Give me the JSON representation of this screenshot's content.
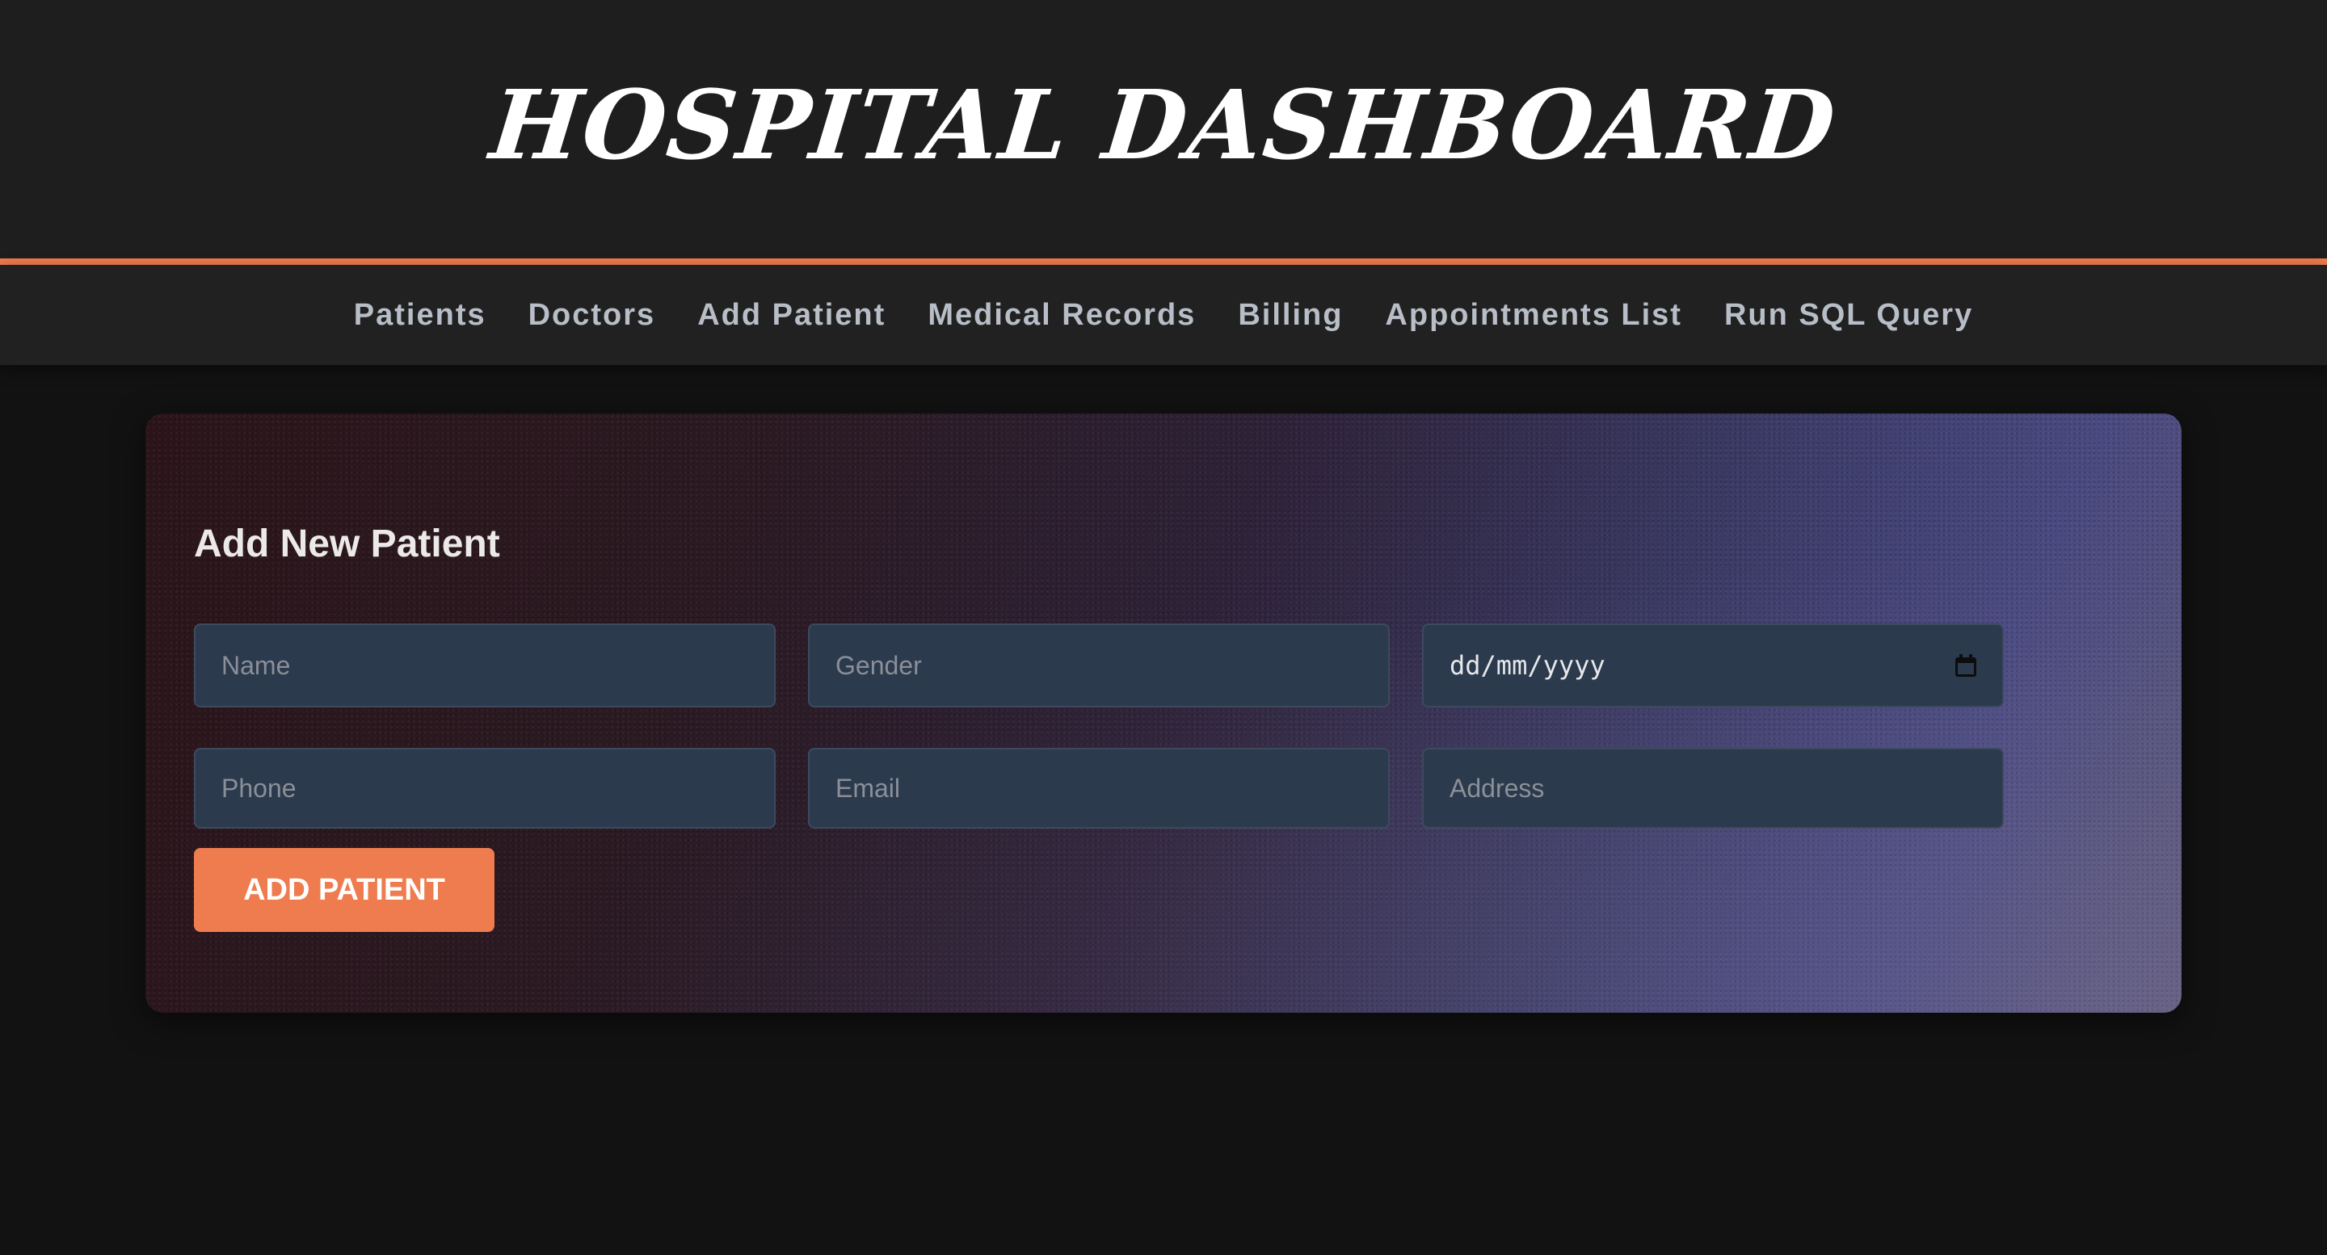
{
  "header": {
    "title": "HOSPITAL DASHBOARD"
  },
  "nav": {
    "items": [
      {
        "label": "Patients"
      },
      {
        "label": "Doctors"
      },
      {
        "label": "Add Patient"
      },
      {
        "label": "Medical Records"
      },
      {
        "label": "Billing"
      },
      {
        "label": "Appointments List"
      },
      {
        "label": "Run SQL Query"
      }
    ]
  },
  "form": {
    "title": "Add New Patient",
    "fields": {
      "name": {
        "placeholder": "Name",
        "value": ""
      },
      "gender": {
        "placeholder": "Gender",
        "value": ""
      },
      "dob": {
        "display": "dd/mm/yyyy",
        "icon": "calendar-icon"
      },
      "phone": {
        "placeholder": "Phone",
        "value": ""
      },
      "email": {
        "placeholder": "Email",
        "value": ""
      },
      "address": {
        "placeholder": "Address",
        "value": ""
      }
    },
    "submit_label": "ADD PATIENT"
  },
  "colors": {
    "accent": "#ee7c4f",
    "header_bg": "#1e1e1e",
    "page_bg": "#121212",
    "input_bg": "#2c3a4d"
  }
}
